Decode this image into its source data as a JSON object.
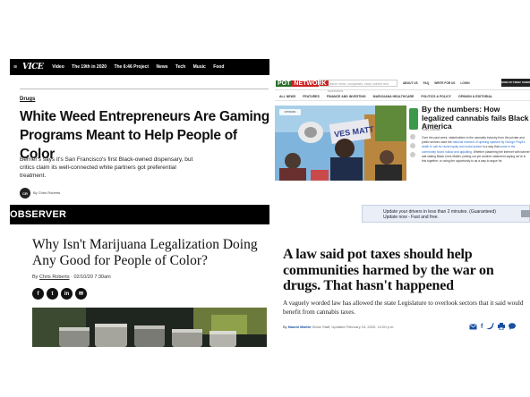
{
  "vice": {
    "menu_icon": "hamburger-icon",
    "logo": "VICE",
    "nav": [
      "Video",
      "The 19th in 2020",
      "The 6:46 Project",
      "News",
      "Tech",
      "Music",
      "Food"
    ],
    "category": "Drugs",
    "headline": "White Weed Entrepreneurs Are Gaming Programs Meant to Help People of Color",
    "dek": "Berner's says it's San Francisco's first Black-owned dispensary, but critics claim its well-connected white partners got preferential treatment.",
    "avatar": "CR",
    "byline": "By Chris Roberts"
  },
  "observer": {
    "brand": "OBSERVER",
    "headline": "Why Isn't Marijuana Legalization Doing Any Good for People of Color?",
    "byline_prefix": "By ",
    "author": "Chris Roberts",
    "date": " · 02/10/20 7:30am",
    "share": [
      {
        "icon": "facebook-icon",
        "glyph": "f"
      },
      {
        "icon": "twitter-icon",
        "glyph": "t"
      },
      {
        "icon": "linkedin-icon",
        "glyph": "in"
      },
      {
        "icon": "email-icon",
        "glyph": "✉"
      }
    ]
  },
  "potnetwork": {
    "logo_pot": "POT",
    "logo_network": "NETWORK",
    "search_placeholder": "Search news, companies, stats, market and scorecards",
    "top_links": [
      "ABOUT US",
      "FAQ",
      "WRITE FOR US",
      "LOGIN"
    ],
    "cta": "SIGN UP FREE! SUBMIT A LIST",
    "nav": [
      "ALL NEWS",
      "FEATURES",
      "FINANCE AND INVESTING",
      "MARIJUANA HEALTHCARE",
      "POLITICS & POLICY",
      "OPINION & EDITORIAL"
    ],
    "photo_label": "OPINION",
    "sign_text": "VES MATT",
    "headline": "By the numbers: How legalized cannabis fails Black America",
    "meta_date": "July 6, 2020",
    "meta_author": "Hilary Lockhart",
    "body_before": "Over the past week, stakeholders in the cannabis industry from the private and public sectors used the ",
    "body_hl1": "national moment of uprising sparked by George Floyd's death to call for racial equity and social justice",
    "body_mid": " in a way that ",
    "body_hl2": "some in the community found hollow and appalling",
    "body_after": ". Whether plastering the internet with banner ads stating Black Lives Matter, putting out yet another statement saying we're in this together, or using the opportunity to as a way to argue for"
  },
  "globe": {
    "ad_text": "Update your drivers in less than 2 minutes. (Guaranteed) Update now - Fast and free.",
    "headline": "A law said pot taxes should help communities harmed by the war on drugs. That hasn't happened",
    "dek": "A vaguely worded law has allowed the state Legislature to overlook sectors that it said would benefit from cannabis taxes.",
    "byline_prefix": "By ",
    "author": "Naomi Martin",
    "meta": " Globe Staff, Updated February 24, 2020, 12:00 p.m.",
    "share_colors": {
      "primary": "#1a4fa0",
      "email": "#1a4fa0"
    }
  }
}
